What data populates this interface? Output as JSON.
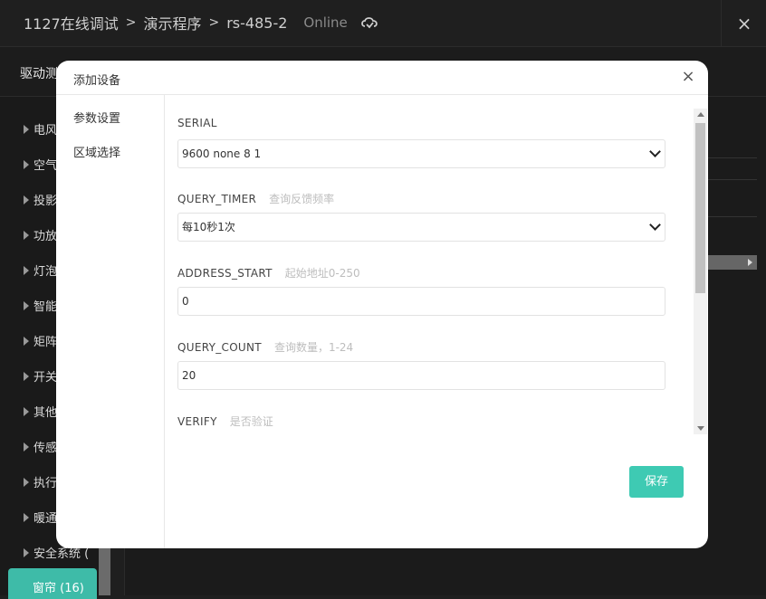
{
  "header": {
    "breadcrumb": [
      "1127在线调试",
      "演示程序",
      "rs-485-2"
    ],
    "separator": ">",
    "status": "Online",
    "close_icon": "×"
  },
  "subbar": {
    "title": "驱动测"
  },
  "sidebar": {
    "items": [
      "电风",
      "空气",
      "投影",
      "功放",
      "灯泡",
      "智能",
      "矩阵",
      "开关",
      "其他",
      "传感",
      "执行",
      "暖通",
      "安全系统 ("
    ],
    "active_item": "窗帘 (16)",
    "accent": "#3ebba8"
  },
  "modal": {
    "title": "添加设备",
    "close_icon": "×",
    "nav": [
      "参数设置",
      "区域选择"
    ],
    "fields": [
      {
        "label": "SERIAL",
        "hint": "",
        "value": "9600 none 8 1",
        "type": "select"
      },
      {
        "label": "QUERY_TIMER",
        "hint": "查询反馈频率",
        "value": "每10秒1次",
        "type": "select"
      },
      {
        "label": "ADDRESS_START",
        "hint": "起始地址0-250",
        "value": "0",
        "type": "input"
      },
      {
        "label": "QUERY_COUNT",
        "hint": "查询数量，1-24",
        "value": "20",
        "type": "input"
      },
      {
        "label": "VERIFY",
        "hint": "是否验证",
        "value": "",
        "type": "label-only"
      }
    ],
    "save_label": "保存",
    "save_color": "#3ecab3"
  }
}
